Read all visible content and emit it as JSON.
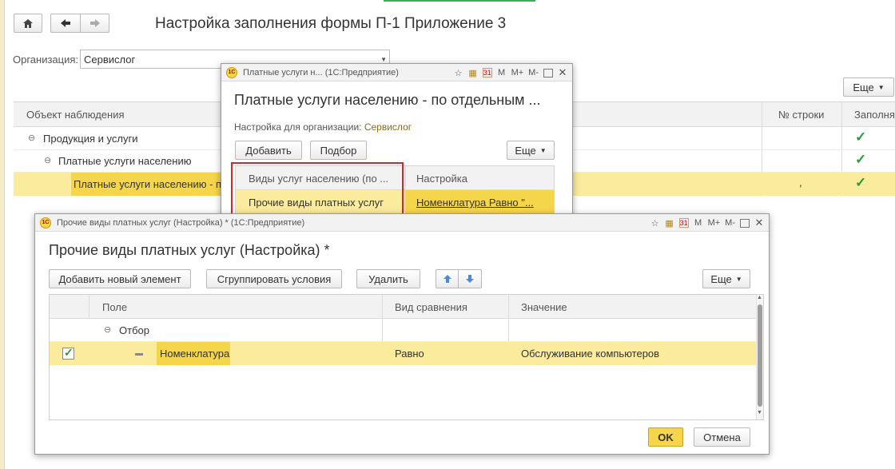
{
  "main": {
    "title": "Настройка заполнения формы П-1 Приложение 3",
    "nav": {
      "home_icon": "home-icon",
      "back_icon": "arrow-left-icon",
      "forward_icon": "arrow-right-icon"
    },
    "org_label": "Организация:",
    "org_value": "Сервислог",
    "more_label": "Еще",
    "table": {
      "headers": [
        "Объект наблюдения",
        "№ строки",
        "Заполнят"
      ],
      "rows": [
        {
          "label": "Продукция и услуги",
          "line_no": "",
          "checked": true
        },
        {
          "label": "Платные услуги населению",
          "line_no": "",
          "checked": true
        },
        {
          "label": "Платные услуги населению - п",
          "line_no": ",",
          "checked": true
        }
      ]
    }
  },
  "mid_window": {
    "caption": "Платные услуги н... (1С:Предприятие)",
    "title": "Платные услуги населению - по отдельным ...",
    "org_label": "Настройка для организации:",
    "org_value": "Сервислог",
    "add_label": "Добавить",
    "select_label": "Подбор",
    "more_label": "Еще",
    "table": {
      "headers": [
        "Виды услуг населению (по ...",
        "Настройка"
      ],
      "row": {
        "type": "Прочие виды платных услуг",
        "setting": "Номенклатура Равно \"..."
      }
    }
  },
  "front_window": {
    "caption": "Прочие виды платных услуг (Настройка) * (1С:Предприятие)",
    "title": "Прочие виды платных услуг (Настройка) *",
    "toolbar": {
      "add_label": "Добавить новый элемент",
      "group_label": "Сгруппировать условия",
      "delete_label": "Удалить",
      "more_label": "Еще"
    },
    "table": {
      "headers": [
        "Поле",
        "Вид сравнения",
        "Значение"
      ],
      "group_row": "Отбор",
      "row": {
        "field": "Номенклатура",
        "comparison": "Равно",
        "value": "Обслуживание компьютеров",
        "checked": true
      }
    },
    "ok_label": "OK",
    "cancel_label": "Отмена"
  },
  "titlebar_icons": {
    "m": "M",
    "m_plus": "M+",
    "m_minus": "M-",
    "calendar": "31"
  },
  "colors": {
    "highlight_yellow": "#fbeb9c",
    "accent_yellow": "#f5d54a",
    "red_frame": "#d9232d",
    "check_green": "#2e9a3a"
  }
}
